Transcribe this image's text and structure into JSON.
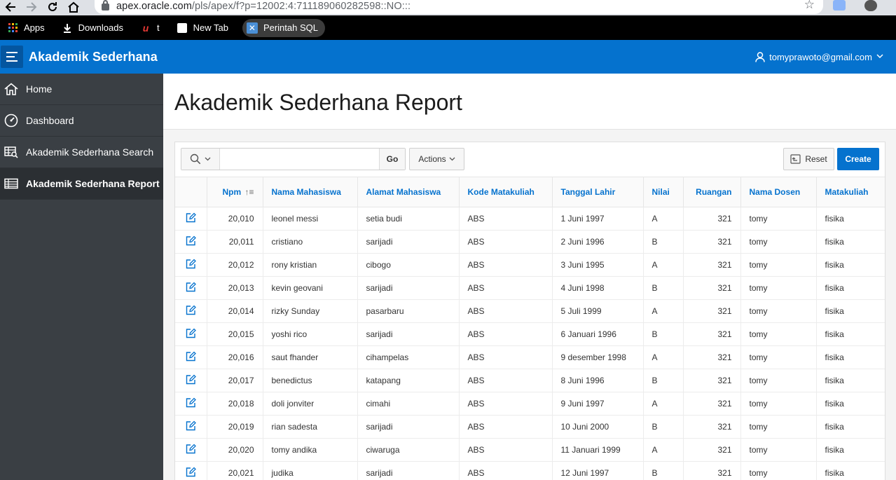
{
  "browser": {
    "url_main": "apex.oracle.com",
    "url_rest": "/pls/apex/f?p=12002:4:711189060282598::NO:::",
    "bookmarks": [
      {
        "label": "Apps",
        "icon": "apps-grid-icon"
      },
      {
        "label": "Downloads",
        "icon": "download-icon"
      },
      {
        "label": "t",
        "icon": "tiktok-icon"
      },
      {
        "label": "New Tab",
        "icon": "page-icon"
      },
      {
        "label": "Perintah SQL",
        "icon": "sql-icon"
      }
    ]
  },
  "header": {
    "app_title": "Akademik Sederhana",
    "user": "tomyprawoto@gmail.com"
  },
  "sidebar": {
    "items": [
      {
        "label": "Home",
        "icon": "home-icon"
      },
      {
        "label": "Dashboard",
        "icon": "dashboard-icon"
      },
      {
        "label": "Akademik Sederhana Search",
        "icon": "search-table-icon"
      },
      {
        "label": "Akademik Sederhana Report",
        "icon": "table-icon"
      }
    ]
  },
  "page": {
    "title": "Akademik Sederhana Report"
  },
  "toolbar": {
    "go_label": "Go",
    "actions_label": "Actions",
    "reset_label": "Reset",
    "create_label": "Create",
    "search_value": ""
  },
  "report": {
    "columns": [
      "Npm",
      "Nama Mahasiswa",
      "Alamat Mahasiswa",
      "Kode Matakuliah",
      "Tanggal Lahir",
      "Nilai",
      "Ruangan",
      "Nama Dosen",
      "Matakuliah"
    ],
    "rows": [
      [
        "20,010",
        "leonel messi",
        "setia budi",
        "ABS",
        "1 Juni 1997",
        "A",
        "321",
        "tomy",
        "fisika"
      ],
      [
        "20,011",
        "cristiano",
        "sarijadi",
        "ABS",
        "2 Juni 1996",
        "B",
        "321",
        "tomy",
        "fisika"
      ],
      [
        "20,012",
        "rony kristian",
        "cibogo",
        "ABS",
        "3 Juni 1995",
        "A",
        "321",
        "tomy",
        "fisika"
      ],
      [
        "20,013",
        "kevin geovani",
        "sarijadi",
        "ABS",
        "4 Juni 1998",
        "B",
        "321",
        "tomy",
        "fisika"
      ],
      [
        "20,014",
        "rizky Sunday",
        "pasarbaru",
        "ABS",
        "5 Juli 1999",
        "A",
        "321",
        "tomy",
        "fisika"
      ],
      [
        "20,015",
        "yoshi rico",
        "sarijadi",
        "ABS",
        "6 Januari 1996",
        "B",
        "321",
        "tomy",
        "fisika"
      ],
      [
        "20,016",
        "saut fhander",
        "cihampelas",
        "ABS",
        "9 desember 1998",
        "A",
        "321",
        "tomy",
        "fisika"
      ],
      [
        "20,017",
        "benedictus",
        "katapang",
        "ABS",
        "8 Juni 1996",
        "B",
        "321",
        "tomy",
        "fisika"
      ],
      [
        "20,018",
        "doli jonviter",
        "cimahi",
        "ABS",
        "9 Juni 1997",
        "A",
        "321",
        "tomy",
        "fisika"
      ],
      [
        "20,019",
        "rian sadesta",
        "sarijadi",
        "ABS",
        "10 Juni 2000",
        "B",
        "321",
        "tomy",
        "fisika"
      ],
      [
        "20,020",
        "tomy andika",
        "ciwaruga",
        "ABS",
        "11 Januari 1999",
        "A",
        "321",
        "tomy",
        "fisika"
      ],
      [
        "20,021",
        "judika",
        "sarijadi",
        "ABS",
        "12 Juni 1997",
        "B",
        "321",
        "tomy",
        "fisika"
      ]
    ]
  },
  "colors": {
    "accent": "#0572ce",
    "sidebar": "#3a3f44",
    "sidebar_active": "#2b2f33"
  }
}
